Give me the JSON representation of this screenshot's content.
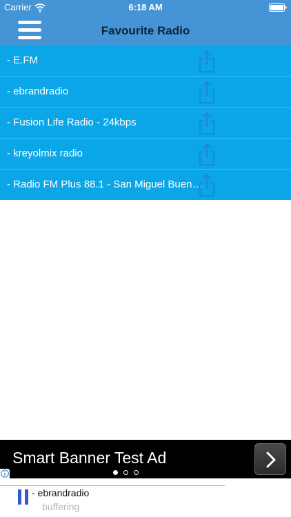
{
  "status_bar": {
    "carrier": "Carrier",
    "time": "6:18 AM",
    "wifi_icon": "wifi-icon",
    "battery_icon": "battery-icon"
  },
  "nav": {
    "title": "Favourite Radio",
    "menu_icon": "hamburger-menu-icon"
  },
  "stations": [
    {
      "label": "- E.FM",
      "share_icon": "share-icon"
    },
    {
      "label": "- ebrandradio",
      "share_icon": "share-icon"
    },
    {
      "label": "- Fusion Life Radio - 24kbps",
      "share_icon": "share-icon"
    },
    {
      "label": "- kreyolmix radio",
      "share_icon": "share-icon"
    },
    {
      "label": "- Radio FM Plus 88.1 - San Miguel Buen…",
      "share_icon": "share-icon"
    }
  ],
  "ad": {
    "title": "Smart Banner Test Ad",
    "arrow_icon": "chevron-right-icon",
    "info_icon": "info-icon",
    "pages": 3,
    "active_page": 1
  },
  "player": {
    "station": "- ebrandradio",
    "status": "buffering",
    "pause_icon": "pause-icon"
  },
  "colors": {
    "nav_background": "#4595d6",
    "list_row": "#0aa6e8",
    "share_icon": "#1e7fd9",
    "title_text": "#0f2335",
    "pause_button": "#2f5bd0",
    "buffering_text": "#b5b5b5"
  }
}
